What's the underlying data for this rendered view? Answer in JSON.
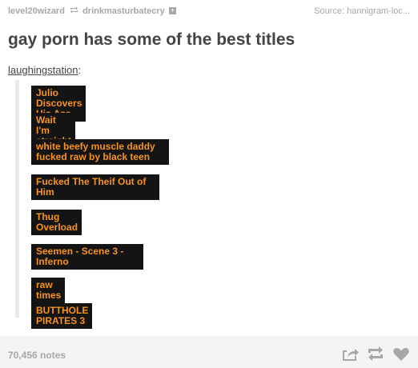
{
  "header": {
    "author": "level20wizard",
    "reblogged_from": "drinkmasturbatecry",
    "source": "Source: hannigram-loc..."
  },
  "post": {
    "title": "gay porn has some of the best titles",
    "reblogger": "laughingstation",
    "reblogger_suffix": ":",
    "titles": [
      "Julio Discovers His Ass",
      "Wait I'm straight",
      "white beefy muscle daddy fucked raw by black teen",
      "Fucked The Theif Out of Him",
      "Thug Overload",
      "Seemen - Scene 3 - Inferno",
      "raw times",
      "BUTTHOLE PIRATES 3"
    ]
  },
  "footer": {
    "notes": "70,456 notes",
    "actions": [
      "share-icon",
      "reblog-icon",
      "like-icon"
    ]
  },
  "colors": {
    "label_bg": "#141414",
    "label_text": "#f7931e",
    "muted": "#a7a7a7",
    "footer_bg": "#f4f4f4"
  }
}
